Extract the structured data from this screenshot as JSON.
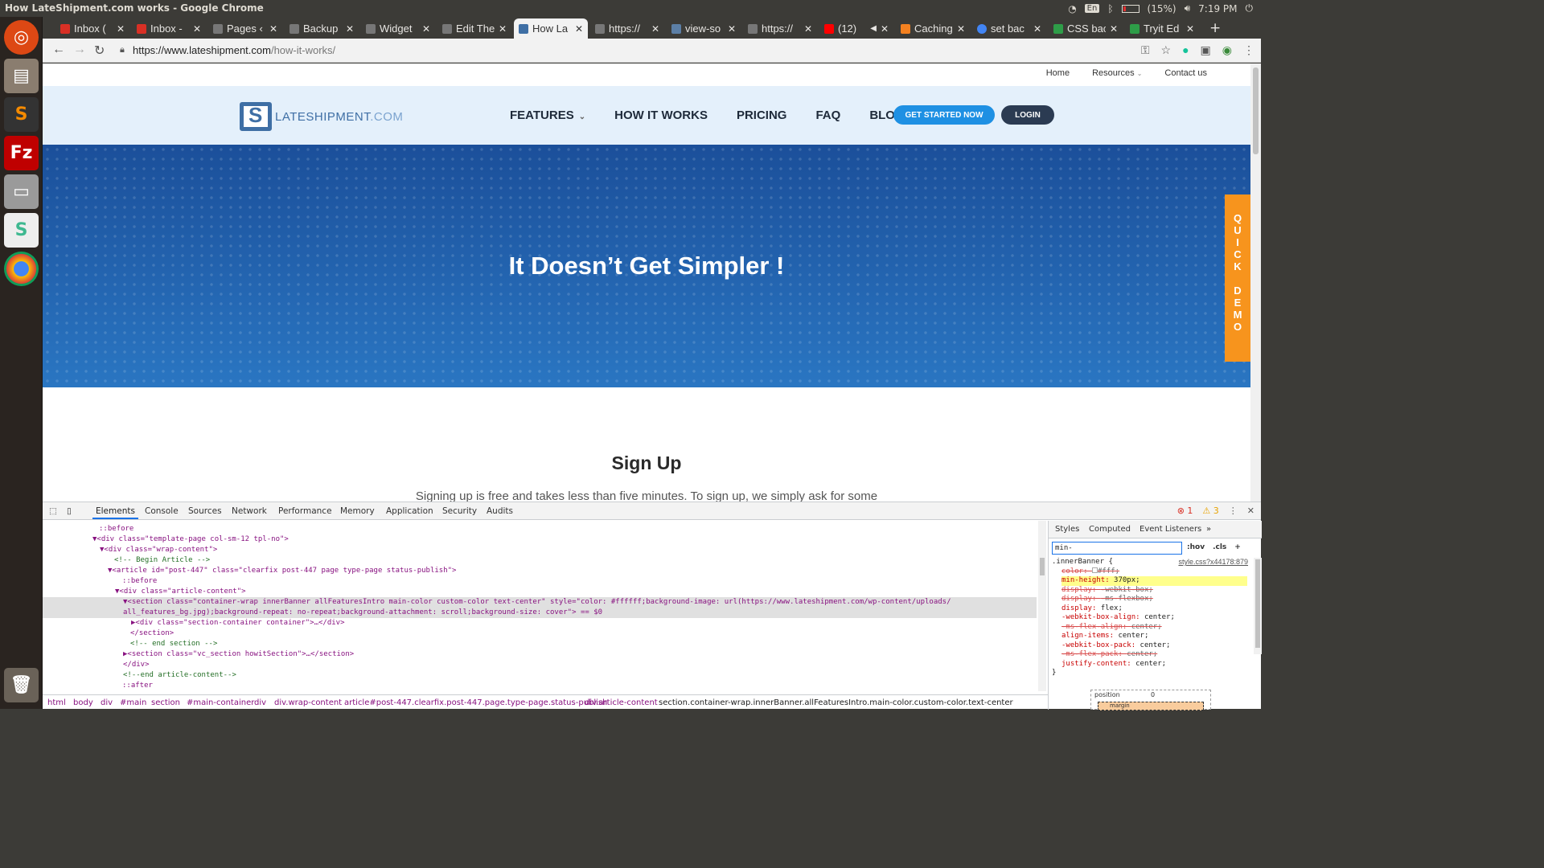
{
  "window": {
    "title": "How LateShipment.com works - Google Chrome"
  },
  "tray": {
    "lang": "En",
    "battery": "(15%)",
    "time": "7:19 PM"
  },
  "tabs": [
    {
      "label": "Inbox (",
      "color": "#d93025"
    },
    {
      "label": "Inbox - ",
      "color": "#d93025"
    },
    {
      "label": "Pages ‹",
      "color": "#777777"
    },
    {
      "label": "Backup",
      "color": "#777777"
    },
    {
      "label": "Widget",
      "color": "#777777"
    },
    {
      "label": "Edit The",
      "color": "#777777"
    },
    {
      "label": "How La",
      "color": "#3f6fa5"
    },
    {
      "label": "https://",
      "color": "#777777"
    },
    {
      "label": "view-so",
      "color": "#5c7fa6"
    },
    {
      "label": "https://",
      "color": "#777777"
    },
    {
      "label": "(12)",
      "color": "#ff0000"
    },
    {
      "label": "Caching",
      "color": "#f48120"
    },
    {
      "label": "set bac",
      "color": "#4285f4"
    },
    {
      "label": "CSS bac",
      "color": "#2e9d48"
    },
    {
      "label": "Tryit Ed",
      "color": "#2e9d48"
    }
  ],
  "address": {
    "host": "https://www.lateshipment.com",
    "path": "/how-it-works/"
  },
  "site": {
    "util_nav": [
      "Home",
      "Resources",
      "Contact us"
    ],
    "logo": {
      "main": "LATESHIPMENT",
      "suffix": ".COM"
    },
    "menu": [
      "FEATURES",
      "HOW IT WORKS",
      "PRICING",
      "FAQ",
      "BLOG"
    ],
    "cta": "GET STARTED NOW",
    "login": "LOGIN",
    "banner_title": "It Doesn’t Get Simpler !",
    "quick_demo": [
      "Q",
      "U",
      "I",
      "C",
      "K",
      "",
      "D",
      "E",
      "M",
      "O"
    ],
    "section_title": "Sign Up",
    "section_text": "Signing up is free and takes less than five minutes. To sign up, we simply ask for some"
  },
  "devtools": {
    "tabs": [
      "Elements",
      "Console",
      "Sources",
      "Network",
      "Performance",
      "Memory",
      "Application",
      "Security",
      "Audits"
    ],
    "errors": "1",
    "warnings": "3",
    "dom_lines": [
      "::before",
      "▼<div class=\"template-page col-sm-12 tpl-no\">",
      "▼<div class=\"wrap-content\">",
      "<!-- Begin Article -->",
      "▼<article id=\"post-447\" class=\"clearfix post-447 page type-page status-publish\">",
      "::before",
      "▼<div class=\"article-content\">",
      "▼<section class=\"container-wrap  innerBanner allFeaturesIntro main-color custom-color  text-center\" style=\"color: #ffffff;background-image: url(https://www.lateshipment.com/wp-content/uploads/",
      "all_features_bg.jpg);background-repeat: no-repeat;background-attachment: scroll;background-size: cover\"> == $0",
      "▶<div class=\"section-container container\">…</div>",
      "</section>",
      "<!-- end section -->",
      "▶<section class=\"vc_section howitSection\">…</section>",
      "</div>",
      "<!--end article-content-->",
      "::after"
    ],
    "breadcrumbs": [
      "html",
      "body",
      "div",
      "#main",
      "section",
      "#main-container",
      "div",
      "div.wrap-content",
      "article#post-447.clearfix.post-447.page.type-page.status-publish",
      "div.article-content",
      "section.container-wrap.innerBanner.allFeaturesIntro.main-color.custom-color.text-center"
    ],
    "styles_tabs": [
      "Styles",
      "Computed",
      "Event Listeners"
    ],
    "filter": "min-",
    "tools": [
      ":hov",
      ".cls",
      "+"
    ],
    "rule": {
      "selector": ".innerBanner {",
      "source": "style.css?x44178:879",
      "decls": [
        {
          "p": "color",
          "v": "#fff;",
          "strike": true
        },
        {
          "p": "min-height",
          "v": "370px;",
          "hl": true
        },
        {
          "p": "display",
          "v": "-webkit-box;",
          "strike": true
        },
        {
          "p": "display",
          "v": "-ms-flexbox;",
          "strike": true
        },
        {
          "p": "display",
          "v": "flex;"
        },
        {
          "p": "-webkit-box-align",
          "v": "center;"
        },
        {
          "p": "-ms-flex-align",
          "v": "center;",
          "strike": true
        },
        {
          "p": "align-items",
          "v": "center;"
        },
        {
          "p": "-webkit-box-pack",
          "v": "center;"
        },
        {
          "p": "-ms-flex-pack",
          "v": "center;",
          "strike": true
        },
        {
          "p": "justify-content",
          "v": "center;"
        }
      ],
      "close": "}"
    },
    "boxmodel": {
      "label": "position",
      "value": "0",
      "margin": "margin"
    }
  }
}
